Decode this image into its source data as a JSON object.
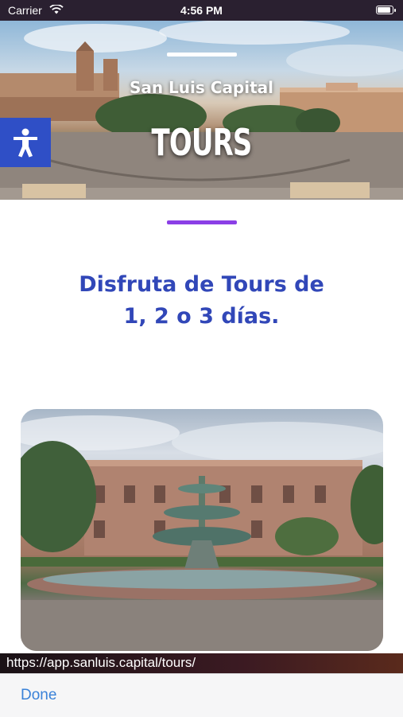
{
  "status_bar": {
    "carrier": "Carrier",
    "time": "4:56 PM",
    "icons": [
      "wifi-icon",
      "battery-icon"
    ]
  },
  "hero": {
    "subtitle": "San Luis Capital",
    "title": "TOURS"
  },
  "accessibility_button": {
    "icon": "accessibility-person-icon"
  },
  "main": {
    "heading_line1": "Disfruta de Tours de",
    "heading_line2": "1, 2 o 3 días."
  },
  "url_bar": {
    "url": "https://app.sanluis.capital/tours/"
  },
  "toolbar": {
    "done_label": "Done"
  },
  "colors": {
    "accent_purple": "#8b3fe6",
    "heading_blue": "#3147b8",
    "a11y_blue": "#2f4fc6",
    "ios_link_blue": "#3a82d8"
  }
}
